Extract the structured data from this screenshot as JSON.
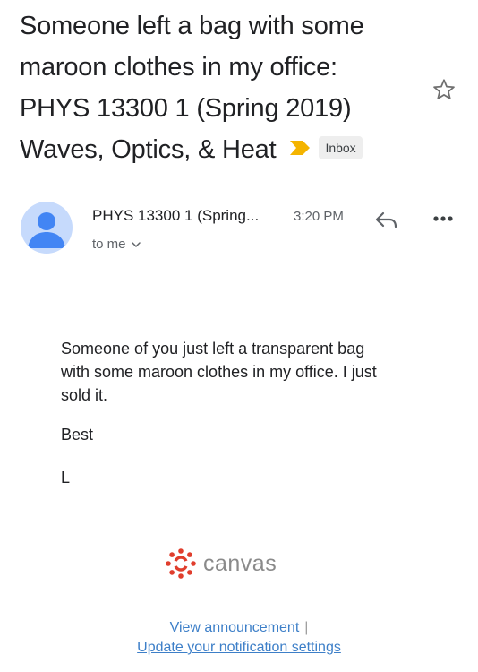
{
  "subject": {
    "title": "Someone left a bag with some maroon clothes in my office: PHYS 13300 1 (Spring 2019) Waves, Optics, & Heat",
    "important_marker_icon": "importance-marker-icon",
    "label": "Inbox",
    "star_icon": "star-outline-icon"
  },
  "message": {
    "sender": "PHYS 13300 1 (Spring...",
    "time": "3:20 PM",
    "recipient": "to me",
    "reply_icon": "reply-icon",
    "more_icon": "more-horizontal-icon",
    "body": "Someone of you just left a transparent bag with some maroon clothes in my office. I just sold it.",
    "signoff": "Best",
    "initial": "L"
  },
  "footer": {
    "logo_text": "canvas",
    "view_link": "View announcement",
    "separator": "|",
    "settings_link": "Update your notification settings"
  },
  "colors": {
    "important": "#f4b400",
    "canvas_red": "#e03e2d",
    "avatar_bg": "#c6dafc",
    "avatar_fg": "#4285f4",
    "link": "#3d7fc8"
  }
}
